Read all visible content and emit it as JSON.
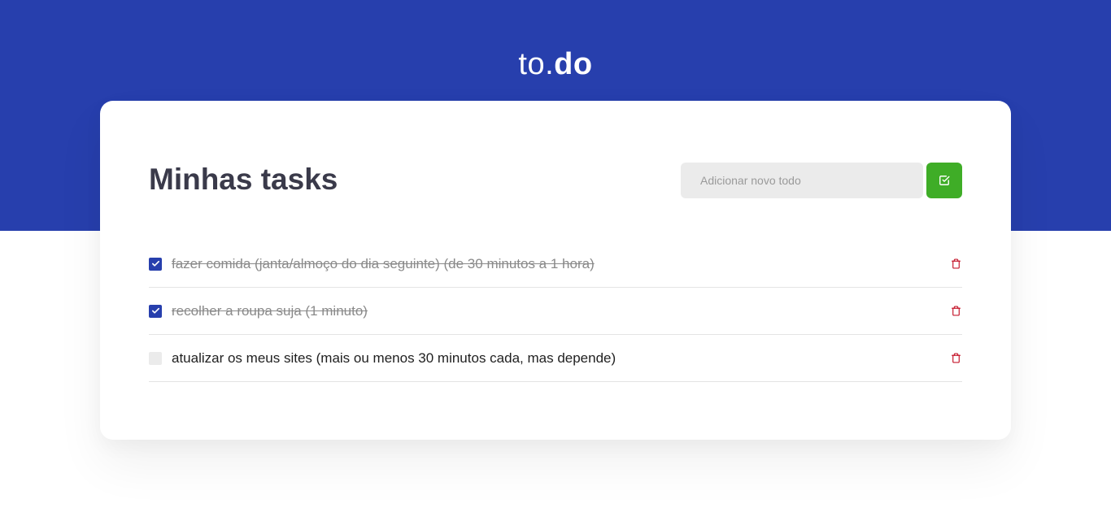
{
  "logo": {
    "light": "to.",
    "bold": "do"
  },
  "card": {
    "title": "Minhas tasks",
    "input_placeholder": "Adicionar novo todo",
    "input_value": ""
  },
  "tasks": [
    {
      "text": "fazer comida (janta/almoço do dia seguinte) (de 30 minutos a 1 hora)",
      "done": true
    },
    {
      "text": "recolher a roupa suja (1 minuto)",
      "done": true
    },
    {
      "text": "atualizar os meus sites (mais ou menos 30 minutos cada, mas depende)",
      "done": false
    }
  ],
  "colors": {
    "brand": "#273fad",
    "add_button": "#3fad27",
    "delete_icon": "#c5192d"
  },
  "icons": {
    "add": "check-square-icon",
    "checkbox": "check-icon",
    "delete": "trash-icon"
  }
}
